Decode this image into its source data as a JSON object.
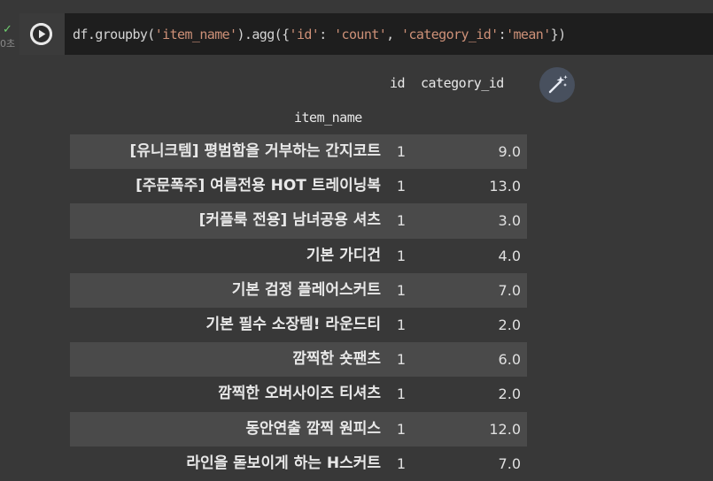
{
  "gutter": {
    "status_icon": "check-icon",
    "status_glyph": "✓",
    "exec_time": "0초"
  },
  "cell": {
    "run_icon": "play-icon",
    "code_parts": [
      {
        "text": "df.groupby(",
        "kind": "def"
      },
      {
        "text": "'item_name'",
        "kind": "str"
      },
      {
        "text": ").agg({",
        "kind": "def"
      },
      {
        "text": "'id'",
        "kind": "str"
      },
      {
        "text": ": ",
        "kind": "def"
      },
      {
        "text": "'count'",
        "kind": "str"
      },
      {
        "text": ", ",
        "kind": "def"
      },
      {
        "text": "'category_id'",
        "kind": "str"
      },
      {
        "text": ":",
        "kind": "def"
      },
      {
        "text": "'mean'",
        "kind": "str"
      },
      {
        "text": "})",
        "kind": "def"
      }
    ]
  },
  "output": {
    "magic_icon": "magic-wand-icon",
    "columns": {
      "id": "id",
      "category_id": "category_id"
    },
    "index_name": "item_name",
    "rows": [
      {
        "name": "[유니크템] 평범함을 거부하는 간지코트",
        "id": "1",
        "category_id": "9.0"
      },
      {
        "name": "[주문폭주] 여름전용 HOT 트레이닝복",
        "id": "1",
        "category_id": "13.0"
      },
      {
        "name": "[커플룩 전용] 남녀공용 셔츠",
        "id": "1",
        "category_id": "3.0"
      },
      {
        "name": "기본 가디건",
        "id": "1",
        "category_id": "4.0"
      },
      {
        "name": "기본 검정 플레어스커트",
        "id": "1",
        "category_id": "7.0"
      },
      {
        "name": "기본 필수 소장템! 라운드티",
        "id": "1",
        "category_id": "2.0"
      },
      {
        "name": "깜찍한 숏팬츠",
        "id": "1",
        "category_id": "6.0"
      },
      {
        "name": "깜찍한 오버사이즈 티셔츠",
        "id": "1",
        "category_id": "2.0"
      },
      {
        "name": "동안연출 깜찍 원피스",
        "id": "1",
        "category_id": "12.0"
      },
      {
        "name": "라인을 돋보이게 하는 H스커트",
        "id": "1",
        "category_id": "7.0"
      }
    ]
  },
  "colors": {
    "editor_bg": "#1e1e1e",
    "output_bg": "#383838",
    "row_alt_bg": "#4a4a4a",
    "string": "#ce9178",
    "success": "#6fcf6f"
  }
}
